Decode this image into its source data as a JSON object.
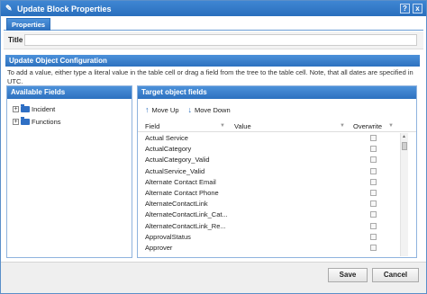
{
  "dialog": {
    "title": "Update Block Properties",
    "help_label": "?",
    "close_label": "x"
  },
  "tabs": [
    {
      "label": "Properties"
    }
  ],
  "title_field": {
    "label": "Title",
    "value": ""
  },
  "section": {
    "heading": "Update Object Configuration",
    "note": "To add a value, either type a literal value in the table cell or drag a field from the tree to the table cell. Note, that all dates are specified in UTC."
  },
  "available_fields": {
    "heading": "Available Fields",
    "tree": [
      {
        "label": "Incident"
      },
      {
        "label": "Functions"
      }
    ]
  },
  "target_fields": {
    "heading": "Target object fields",
    "move_up": "Move Up",
    "move_down": "Move Down",
    "columns": {
      "field": "Field",
      "value": "Value",
      "overwrite": "Overwrite"
    },
    "rows": [
      "Actual Service",
      "ActualCategory",
      "ActualCategory_Valid",
      "ActualService_Valid",
      "Alternate Contact Email",
      "Alternate Contact Phone",
      "AlternateContactLink",
      "AlternateContactLink_Cat...",
      "AlternateContactLink_Re...",
      "ApprovalStatus",
      "Approver"
    ]
  },
  "footer": {
    "save": "Save",
    "cancel": "Cancel"
  }
}
